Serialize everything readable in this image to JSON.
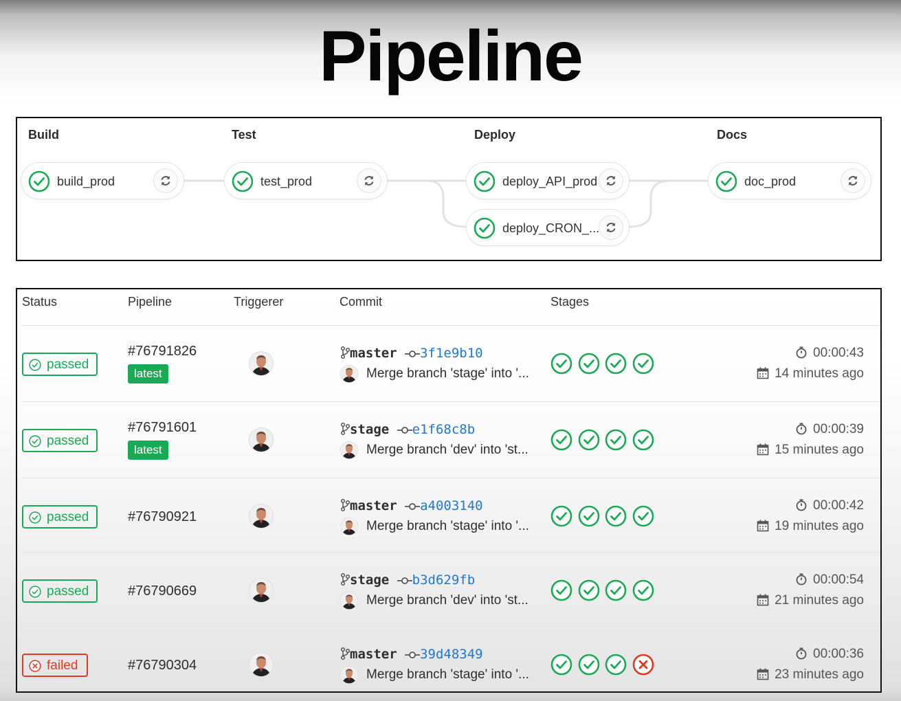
{
  "page": {
    "title": "Pipeline"
  },
  "graph": {
    "stages": [
      {
        "name": "Build",
        "jobs": [
          {
            "name": "build_prod",
            "status": "passed"
          }
        ]
      },
      {
        "name": "Test",
        "jobs": [
          {
            "name": "test_prod",
            "status": "passed"
          }
        ]
      },
      {
        "name": "Deploy",
        "jobs": [
          {
            "name": "deploy_API_prod",
            "status": "passed"
          },
          {
            "name": "deploy_CRON_...",
            "status": "passed"
          }
        ]
      },
      {
        "name": "Docs",
        "jobs": [
          {
            "name": "doc_prod",
            "status": "passed"
          }
        ]
      }
    ],
    "icons": {
      "job_status": "check-circle-icon",
      "retry": "retry-icon"
    }
  },
  "table": {
    "headers": {
      "status": "Status",
      "pipeline": "Pipeline",
      "triggerer": "Triggerer",
      "commit": "Commit",
      "stages": "Stages"
    },
    "rows": [
      {
        "status": "passed",
        "pipeline_id": "#76791826",
        "latest": "latest",
        "branch": "master",
        "sha": "3f1e9b10",
        "message": "Merge branch 'stage' into '...",
        "stages": [
          "passed",
          "passed",
          "passed",
          "passed"
        ],
        "duration": "00:00:43",
        "ago": "14 minutes ago"
      },
      {
        "status": "passed",
        "pipeline_id": "#76791601",
        "latest": "latest",
        "branch": "stage",
        "sha": "e1f68c8b",
        "message": "Merge branch 'dev' into 'st...",
        "stages": [
          "passed",
          "passed",
          "passed",
          "passed"
        ],
        "duration": "00:00:39",
        "ago": "15 minutes ago"
      },
      {
        "status": "passed",
        "pipeline_id": "#76790921",
        "latest": null,
        "branch": "master",
        "sha": "a4003140",
        "message": "Merge branch 'stage' into '...",
        "stages": [
          "passed",
          "passed",
          "passed",
          "passed"
        ],
        "duration": "00:00:42",
        "ago": "19 minutes ago"
      },
      {
        "status": "passed",
        "pipeline_id": "#76790669",
        "latest": null,
        "branch": "stage",
        "sha": "b3d629fb",
        "message": "Merge branch 'dev' into 'st...",
        "stages": [
          "passed",
          "passed",
          "passed",
          "passed"
        ],
        "duration": "00:00:54",
        "ago": "21 minutes ago"
      },
      {
        "status": "failed",
        "pipeline_id": "#76790304",
        "latest": null,
        "branch": "master",
        "sha": "39d48349",
        "message": "Merge branch 'stage' into '...",
        "stages": [
          "passed",
          "passed",
          "passed",
          "failed"
        ],
        "duration": "00:00:36",
        "ago": "23 minutes ago"
      }
    ]
  },
  "colors": {
    "success": "#1aaa55",
    "failed": "#db3b21",
    "sha_link": "#1f78d1",
    "latest_badge": "#1aaa55"
  }
}
